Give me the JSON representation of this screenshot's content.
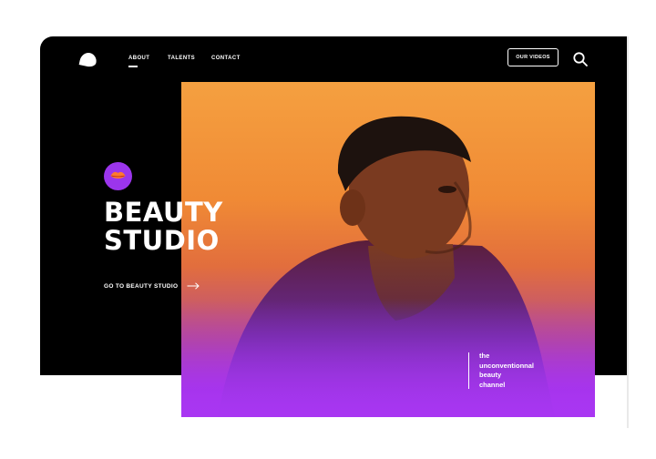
{
  "nav": {
    "logo_icon": "leaf-logo-icon",
    "links": [
      "ABOUT",
      "TALENTS",
      "CONTACT"
    ],
    "active_link": "ABOUT",
    "videos_button": "OUR VIDEOS",
    "search_icon": "search-icon"
  },
  "hero": {
    "badge_icon": "lips-icon",
    "title_line1": "BEAUTY",
    "title_line2": "STUDIO",
    "cta_label": "GO TO BEAUTY STUDIO",
    "cta_icon": "arrow-right-icon",
    "tagline": [
      "the",
      "unconventionnal",
      "beauty",
      "channel"
    ]
  },
  "colors": {
    "background": "#000000",
    "accent_purple": "#9b35ec",
    "photo_orange": "#f08a35",
    "photo_purple": "#a936f2",
    "text": "#ffffff"
  }
}
